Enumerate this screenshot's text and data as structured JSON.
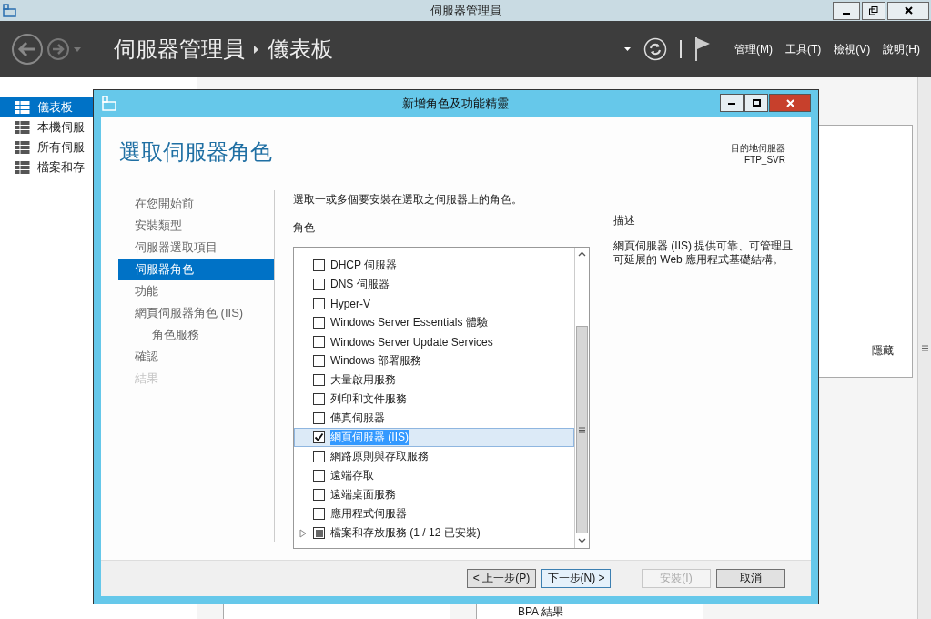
{
  "window": {
    "title": "伺服器管理員"
  },
  "header": {
    "breadcrumb": [
      "伺服器管理員",
      "儀表板"
    ],
    "menu": [
      "管理(M)",
      "工具(T)",
      "檢視(V)",
      "說明(H)"
    ]
  },
  "sidebar": {
    "items": [
      {
        "label": "儀表板",
        "selected": true
      },
      {
        "label": "本機伺服",
        "selected": false
      },
      {
        "label": "所有伺服",
        "selected": false
      },
      {
        "label": "檔案和存",
        "selected": false
      }
    ]
  },
  "background": {
    "panel_link": "隱藏",
    "bottom_label": "BPA 結果"
  },
  "dialog": {
    "title": "新增角色及功能精靈",
    "heading": "選取伺服器角色",
    "destination_label": "目的地伺服器",
    "destination_server": "FTP_SVR",
    "steps": [
      {
        "label": "在您開始前",
        "selected": false,
        "disabled": false
      },
      {
        "label": "安裝類型",
        "selected": false,
        "disabled": false
      },
      {
        "label": "伺服器選取項目",
        "selected": false,
        "disabled": false
      },
      {
        "label": "伺服器角色",
        "selected": true,
        "disabled": false
      },
      {
        "label": "功能",
        "selected": false,
        "disabled": false
      },
      {
        "label": "網頁伺服器角色 (IIS)",
        "selected": false,
        "disabled": false,
        "children": [
          {
            "label": "角色服務",
            "selected": false,
            "disabled": false
          }
        ]
      },
      {
        "label": "確認",
        "selected": false,
        "disabled": false
      },
      {
        "label": "結果",
        "selected": false,
        "disabled": true
      }
    ],
    "instruction": "選取一或多個要安裝在選取之伺服器上的角色。",
    "roles_label": "角色",
    "roles": [
      {
        "kind": "role",
        "label": "DHCP 伺服器",
        "checked": false,
        "selected": false
      },
      {
        "kind": "role",
        "label": "DNS 伺服器",
        "checked": false,
        "selected": false
      },
      {
        "kind": "role",
        "label": "Hyper-V",
        "checked": false,
        "selected": false
      },
      {
        "kind": "role",
        "label": "Windows Server Essentials 體驗",
        "checked": false,
        "selected": false
      },
      {
        "kind": "role",
        "label": "Windows Server Update Services",
        "checked": false,
        "selected": false
      },
      {
        "kind": "role",
        "label": "Windows 部署服務",
        "checked": false,
        "selected": false
      },
      {
        "kind": "role",
        "label": "大量啟用服務",
        "checked": false,
        "selected": false
      },
      {
        "kind": "role",
        "label": "列印和文件服務",
        "checked": false,
        "selected": false
      },
      {
        "kind": "role",
        "label": "傳真伺服器",
        "checked": false,
        "selected": false
      },
      {
        "kind": "role",
        "label": "網頁伺服器 (IIS)",
        "checked": true,
        "selected": true
      },
      {
        "kind": "role",
        "label": "網路原則與存取服務",
        "checked": false,
        "selected": false
      },
      {
        "kind": "role",
        "label": "遠端存取",
        "checked": false,
        "selected": false
      },
      {
        "kind": "role",
        "label": "遠端桌面服務",
        "checked": false,
        "selected": false
      },
      {
        "kind": "role",
        "label": "應用程式伺服器",
        "checked": false,
        "selected": false
      },
      {
        "kind": "partial_group",
        "label": "檔案和存放服務 (1 / 12 已安裝)",
        "checked": false,
        "selected": false
      }
    ],
    "description_label": "描述",
    "description": "網頁伺服器 (IIS) 提供可靠、可管理且可延展的 Web 應用程式基礎結構。",
    "buttons": [
      {
        "label": "< 上一步(P)",
        "disabled": false,
        "default": false
      },
      {
        "label": "下一步(N) >",
        "disabled": false,
        "default": true
      },
      {
        "label": "安裝(I)",
        "disabled": true,
        "default": false
      },
      {
        "label": "取消",
        "disabled": false,
        "default": false
      }
    ]
  }
}
